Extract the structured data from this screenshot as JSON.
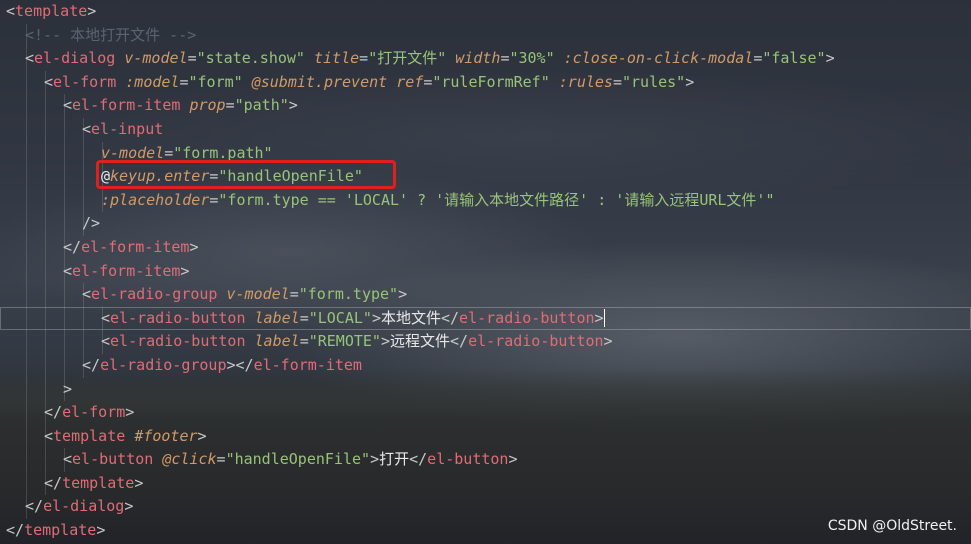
{
  "editor": {
    "lines": [
      {
        "indent": 0,
        "tokens": [
          [
            "brk",
            "<"
          ],
          [
            "tag",
            "template"
          ],
          [
            "brk",
            ">"
          ]
        ]
      },
      {
        "indent": 1,
        "tokens": [
          [
            "comment",
            "<!-- 本地打开文件 -->"
          ]
        ]
      },
      {
        "indent": 1,
        "tokens": [
          [
            "brk",
            "<"
          ],
          [
            "tag",
            "el-dialog"
          ],
          [
            "txt",
            " "
          ],
          [
            "attr",
            "v-model"
          ],
          [
            "eq",
            "="
          ],
          [
            "str",
            "\"state.show\""
          ],
          [
            "txt",
            " "
          ],
          [
            "attr",
            "title"
          ],
          [
            "eq",
            "="
          ],
          [
            "str",
            "\"打开文件\""
          ],
          [
            "txt",
            " "
          ],
          [
            "attr",
            "width"
          ],
          [
            "eq",
            "="
          ],
          [
            "str",
            "\"30%\""
          ],
          [
            "txt",
            " "
          ],
          [
            "attr",
            ":close-on-click-modal"
          ],
          [
            "eq",
            "="
          ],
          [
            "str",
            "\"false\""
          ],
          [
            "brk",
            ">"
          ]
        ]
      },
      {
        "indent": 2,
        "tokens": [
          [
            "brk",
            "<"
          ],
          [
            "tag",
            "el-form"
          ],
          [
            "txt",
            " "
          ],
          [
            "attr",
            ":model"
          ],
          [
            "eq",
            "="
          ],
          [
            "str",
            "\"form\""
          ],
          [
            "txt",
            " "
          ],
          [
            "attr",
            "@submit.prevent"
          ],
          [
            "txt",
            " "
          ],
          [
            "attr",
            "ref"
          ],
          [
            "eq",
            "="
          ],
          [
            "str",
            "\"ruleFormRef\""
          ],
          [
            "txt",
            " "
          ],
          [
            "attr",
            ":rules"
          ],
          [
            "eq",
            "="
          ],
          [
            "str",
            "\"rules\""
          ],
          [
            "brk",
            ">"
          ]
        ]
      },
      {
        "indent": 3,
        "tokens": [
          [
            "brk",
            "<"
          ],
          [
            "tag",
            "el-form-item"
          ],
          [
            "txt",
            " "
          ],
          [
            "attr",
            "prop"
          ],
          [
            "eq",
            "="
          ],
          [
            "str",
            "\"path\""
          ],
          [
            "brk",
            ">"
          ]
        ]
      },
      {
        "indent": 4,
        "tokens": [
          [
            "brk",
            "<"
          ],
          [
            "tag",
            "el-input"
          ]
        ]
      },
      {
        "indent": 5,
        "tokens": [
          [
            "attr",
            "v-model"
          ],
          [
            "eq",
            "="
          ],
          [
            "str",
            "\"form.path\""
          ]
        ]
      },
      {
        "indent": 5,
        "tokens": [
          [
            "at",
            "@"
          ],
          [
            "attr",
            "keyup.enter"
          ],
          [
            "eq",
            "="
          ],
          [
            "str",
            "\"handleOpenFile\""
          ]
        ]
      },
      {
        "indent": 5,
        "tokens": [
          [
            "attr",
            ":placeholder"
          ],
          [
            "eq",
            "="
          ],
          [
            "str",
            "\"form.type == 'LOCAL' ? '请输入本地文件路径' : '请输入远程URL文件'\""
          ]
        ]
      },
      {
        "indent": 4,
        "tokens": [
          [
            "brk",
            "/>"
          ]
        ]
      },
      {
        "indent": 3,
        "tokens": [
          [
            "brk",
            "</"
          ],
          [
            "tag",
            "el-form-item"
          ],
          [
            "brk",
            ">"
          ]
        ]
      },
      {
        "indent": 3,
        "tokens": [
          [
            "brk",
            "<"
          ],
          [
            "tag",
            "el-form-item"
          ],
          [
            "brk",
            ">"
          ]
        ]
      },
      {
        "indent": 4,
        "tokens": [
          [
            "brk",
            "<"
          ],
          [
            "tag",
            "el-radio-group"
          ],
          [
            "txt",
            " "
          ],
          [
            "attr",
            "v-model"
          ],
          [
            "eq",
            "="
          ],
          [
            "str",
            "\"form.type\""
          ],
          [
            "brk",
            ">"
          ]
        ]
      },
      {
        "indent": 5,
        "cursor": true,
        "tokens": [
          [
            "brk",
            "<"
          ],
          [
            "tag",
            "el-radio-button"
          ],
          [
            "txt",
            " "
          ],
          [
            "attr",
            "label"
          ],
          [
            "eq",
            "="
          ],
          [
            "str",
            "\"LOCAL\""
          ],
          [
            "brk",
            ">"
          ],
          [
            "txt",
            "本地文件"
          ],
          [
            "brk",
            "</"
          ],
          [
            "tag",
            "el-radio-button"
          ],
          [
            "brk",
            ">"
          ]
        ]
      },
      {
        "indent": 5,
        "tokens": [
          [
            "brk",
            "<"
          ],
          [
            "tag",
            "el-radio-button"
          ],
          [
            "txt",
            " "
          ],
          [
            "attr",
            "label"
          ],
          [
            "eq",
            "="
          ],
          [
            "str",
            "\"REMOTE\""
          ],
          [
            "brk",
            ">"
          ],
          [
            "txt",
            "远程文件"
          ],
          [
            "brk",
            "</"
          ],
          [
            "tag",
            "el-radio-button"
          ],
          [
            "brk",
            ">"
          ]
        ]
      },
      {
        "indent": 4,
        "tokens": [
          [
            "brk",
            "</"
          ],
          [
            "tag",
            "el-radio-group"
          ],
          [
            "brk",
            "></"
          ],
          [
            "tag",
            "el-form-item"
          ]
        ]
      },
      {
        "indent": 3,
        "tokens": [
          [
            "brk",
            ">"
          ]
        ]
      },
      {
        "indent": 2,
        "tokens": [
          [
            "brk",
            "</"
          ],
          [
            "tag",
            "el-form"
          ],
          [
            "brk",
            ">"
          ]
        ]
      },
      {
        "indent": 2,
        "tokens": [
          [
            "brk",
            "<"
          ],
          [
            "tag",
            "template"
          ],
          [
            "txt",
            " "
          ],
          [
            "attr",
            "#footer"
          ],
          [
            "brk",
            ">"
          ]
        ]
      },
      {
        "indent": 3,
        "tokens": [
          [
            "brk",
            "<"
          ],
          [
            "tag",
            "el-button"
          ],
          [
            "txt",
            " "
          ],
          [
            "attr",
            "@click"
          ],
          [
            "eq",
            "="
          ],
          [
            "str",
            "\"handleOpenFile\""
          ],
          [
            "brk",
            ">"
          ],
          [
            "txt",
            "打开"
          ],
          [
            "brk",
            "</"
          ],
          [
            "tag",
            "el-button"
          ],
          [
            "brk",
            ">"
          ]
        ]
      },
      {
        "indent": 2,
        "tokens": [
          [
            "brk",
            "</"
          ],
          [
            "tag",
            "template"
          ],
          [
            "brk",
            ">"
          ]
        ]
      },
      {
        "indent": 1,
        "tokens": [
          [
            "brk",
            "</"
          ],
          [
            "tag",
            "el-dialog"
          ],
          [
            "brk",
            ">"
          ]
        ]
      },
      {
        "indent": 0,
        "tokens": [
          [
            "brk",
            "</"
          ],
          [
            "tag",
            "template"
          ],
          [
            "brk",
            ">"
          ]
        ]
      }
    ]
  },
  "watermark": "CSDN @OldStreet.",
  "colors": {
    "tag": "#e06c75",
    "attribute": "#d19a66",
    "string": "#98c379",
    "comment": "#5c6370",
    "highlight_box": "#e02020"
  }
}
